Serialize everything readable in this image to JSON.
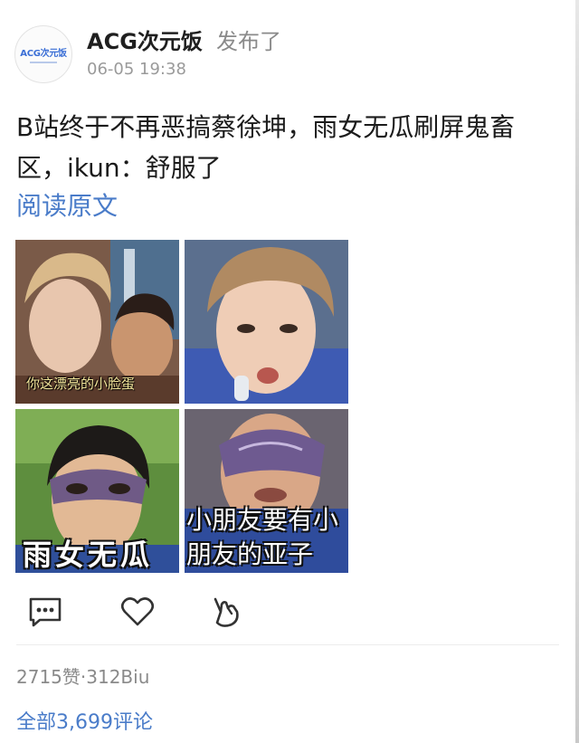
{
  "post": {
    "author": "ACG次元饭",
    "action_label": "发布了",
    "timestamp": "06-05 19:38",
    "avatar_text": "ACG次元饭",
    "text": "B站终于不再恶搞蔡徐坤，雨女无瓜刷屏鬼畜区，ikun：舒服了",
    "read_original_label": "阅读原文"
  },
  "images": {
    "caption_1": "你这漂亮的小脸蛋",
    "caption_3": "雨女无瓜",
    "caption_4": "小朋友要有小朋友的亚子"
  },
  "stats": {
    "text": "2715赞·312Biu"
  },
  "comments": {
    "all_label": "全部3,699评论"
  },
  "colors": {
    "link": "#4a7cc9",
    "muted": "#8a8a8a",
    "text": "#1b1b1b"
  },
  "icons": {
    "comment": "comment-icon",
    "like": "heart-icon",
    "share": "biu-hand-icon"
  }
}
